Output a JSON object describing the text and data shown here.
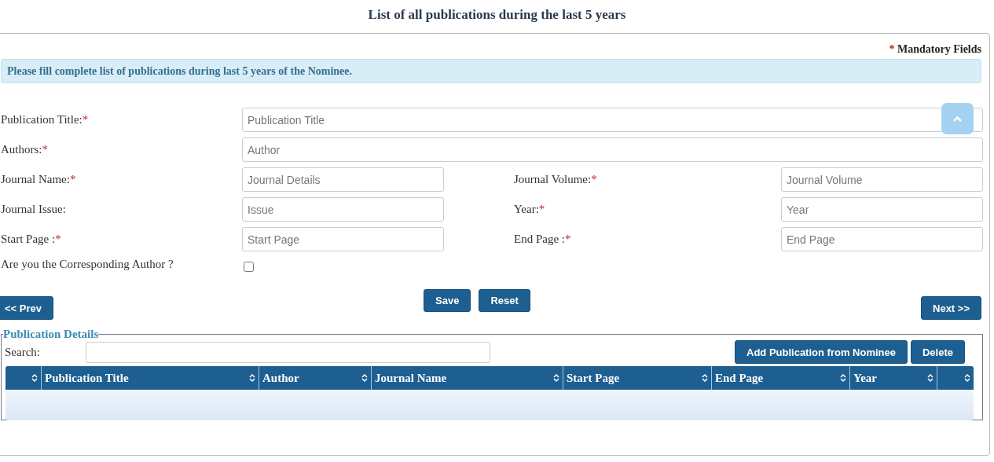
{
  "page_title": "List of all publications during the last 5 years",
  "mandatory_note": {
    "mark": "*",
    "text": "Mandatory Fields"
  },
  "info": "Please fill complete list of publications during last 5 years of the Nominee.",
  "rows": [
    [
      {
        "kind": "text",
        "label": "Publication Title:",
        "mark": "*",
        "placeholder": "Publication Title"
      }
    ],
    [
      {
        "kind": "text",
        "label": "Authors:",
        "mark": "*",
        "placeholder": "Author"
      }
    ],
    [
      {
        "kind": "text",
        "label": "Journal Name:",
        "mark": "*",
        "placeholder": "Journal Details"
      },
      {
        "kind": "text",
        "label": "Journal Volume:",
        "mark": "*",
        "placeholder": "Journal Volume"
      }
    ],
    [
      {
        "kind": "text",
        "label": "Journal Issue:",
        "placeholder": "Issue"
      },
      {
        "kind": "text",
        "label": "Year:",
        "mark": "*",
        "placeholder": "Year"
      }
    ],
    [
      {
        "kind": "text",
        "label": "Start Page :",
        "mark": "*",
        "placeholder": "Start Page"
      },
      {
        "kind": "text",
        "label": "End Page :",
        "mark": "*",
        "placeholder": "End Page"
      }
    ],
    [
      {
        "kind": "checkbox",
        "label": "Are you the Corresponding Author ?",
        "checked": false
      }
    ]
  ],
  "actions": [
    "Save",
    "Reset"
  ],
  "nav": {
    "prev": "<< Prev",
    "next": "Next >>"
  },
  "details": {
    "legend": "Publication Details",
    "search_label": "Search:",
    "buttons": [
      "Add Publication from Nominee",
      "Delete"
    ],
    "columns": [
      {
        "kind": "blank"
      },
      {
        "kind": "text",
        "label": "Publication Title"
      },
      {
        "kind": "text",
        "label": "Author"
      },
      {
        "kind": "text",
        "label": "Journal Name"
      },
      {
        "kind": "text",
        "label": "Start Page"
      },
      {
        "kind": "text",
        "label": "End Page"
      },
      {
        "kind": "text",
        "label": "Year"
      },
      {
        "kind": "blank"
      }
    ]
  }
}
